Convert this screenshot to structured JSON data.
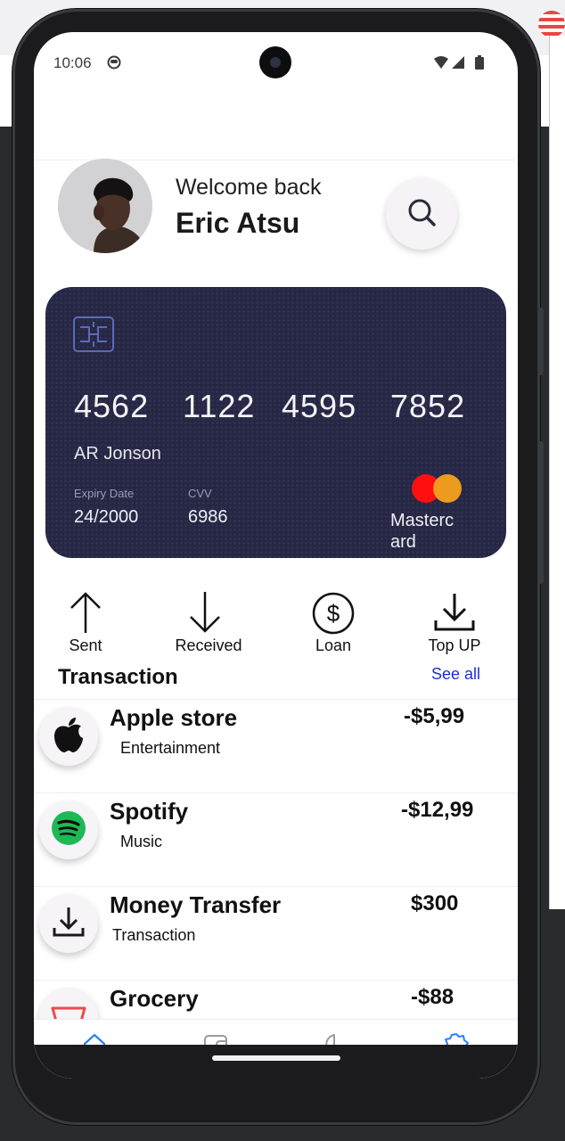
{
  "status_bar": {
    "time": "10:06",
    "icons": [
      "ghost-status-icon",
      "wifi-icon",
      "signal-icon",
      "battery-icon"
    ]
  },
  "header": {
    "welcome_text": "Welcome back",
    "user_name": "Eric Atsu",
    "search_icon": "search-icon"
  },
  "card": {
    "number_groups": [
      "4562",
      "1122",
      "4595",
      "7852"
    ],
    "holder_name": "AR Jonson",
    "expiry_label": "Expiry Date",
    "expiry_value": "24/2000",
    "cvv_label": "CVV",
    "cvv_value": "6986",
    "brand": "Mastercard",
    "colors": {
      "background": "#262745",
      "mc_red": "#ff0f0f",
      "mc_orange": "#f5a11c"
    }
  },
  "actions": [
    {
      "label": "Sent",
      "icon": "arrow-up-icon"
    },
    {
      "label": "Received",
      "icon": "arrow-down-icon"
    },
    {
      "label": "Loan",
      "icon": "dollar-circle-icon"
    },
    {
      "label": "Top UP",
      "icon": "download-icon"
    }
  ],
  "transactions_section": {
    "title": "Transaction",
    "see_all": "See all",
    "link_color": "#1a2fd6"
  },
  "transactions": [
    {
      "name": "Apple store",
      "category": "Entertainment",
      "amount": "-$5,99",
      "icon": "apple-icon"
    },
    {
      "name": "Spotify",
      "category": "Music",
      "amount": "-$12,99",
      "icon": "spotify-icon"
    },
    {
      "name": "Money Transfer",
      "category": "Transaction",
      "amount": "$300",
      "icon": "download-icon"
    },
    {
      "name": "Grocery",
      "category": "",
      "amount": "-$88",
      "icon": "basket-icon"
    }
  ],
  "bottom_nav": {
    "items": [
      "home-icon",
      "wallet-icon",
      "chart-icon",
      "settings-icon"
    ],
    "active": "home-icon",
    "active_color": "#2d7ff9"
  }
}
